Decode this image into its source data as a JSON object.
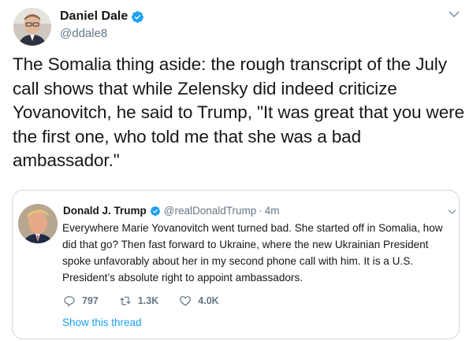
{
  "tweet": {
    "author": {
      "display_name": "Daniel Dale",
      "handle": "@ddale8",
      "verified": true
    },
    "text": "The Somalia thing aside: the rough transcript of the July call shows that while Zelensky did indeed criticize Yovanovitch, he said to Trump, \"It was great that you were the first one, who told me that she was a bad ambassador.\""
  },
  "quoted_tweet": {
    "author": {
      "display_name": "Donald J. Trump",
      "handle": "@realDonaldTrump",
      "verified": true
    },
    "separator": "·",
    "time": "4m",
    "text": "Everywhere Marie Yovanovitch went turned bad. She started off in Somalia, how did that go? Then fast forward to Ukraine, where the new Ukrainian President spoke unfavorably about her in my second phone call with him. It is a U.S. President’s absolute right to appoint ambassadors.",
    "actions": {
      "replies": "797",
      "retweets": "1.3K",
      "likes": "4.0K"
    },
    "show_thread": "Show this thread"
  },
  "colors": {
    "accent": "#1da1f2",
    "secondary_text": "#657786",
    "border": "#ccd6dd"
  },
  "icons": [
    "verified-badge-icon",
    "chevron-down-icon",
    "reply-icon",
    "retweet-icon",
    "like-icon"
  ]
}
